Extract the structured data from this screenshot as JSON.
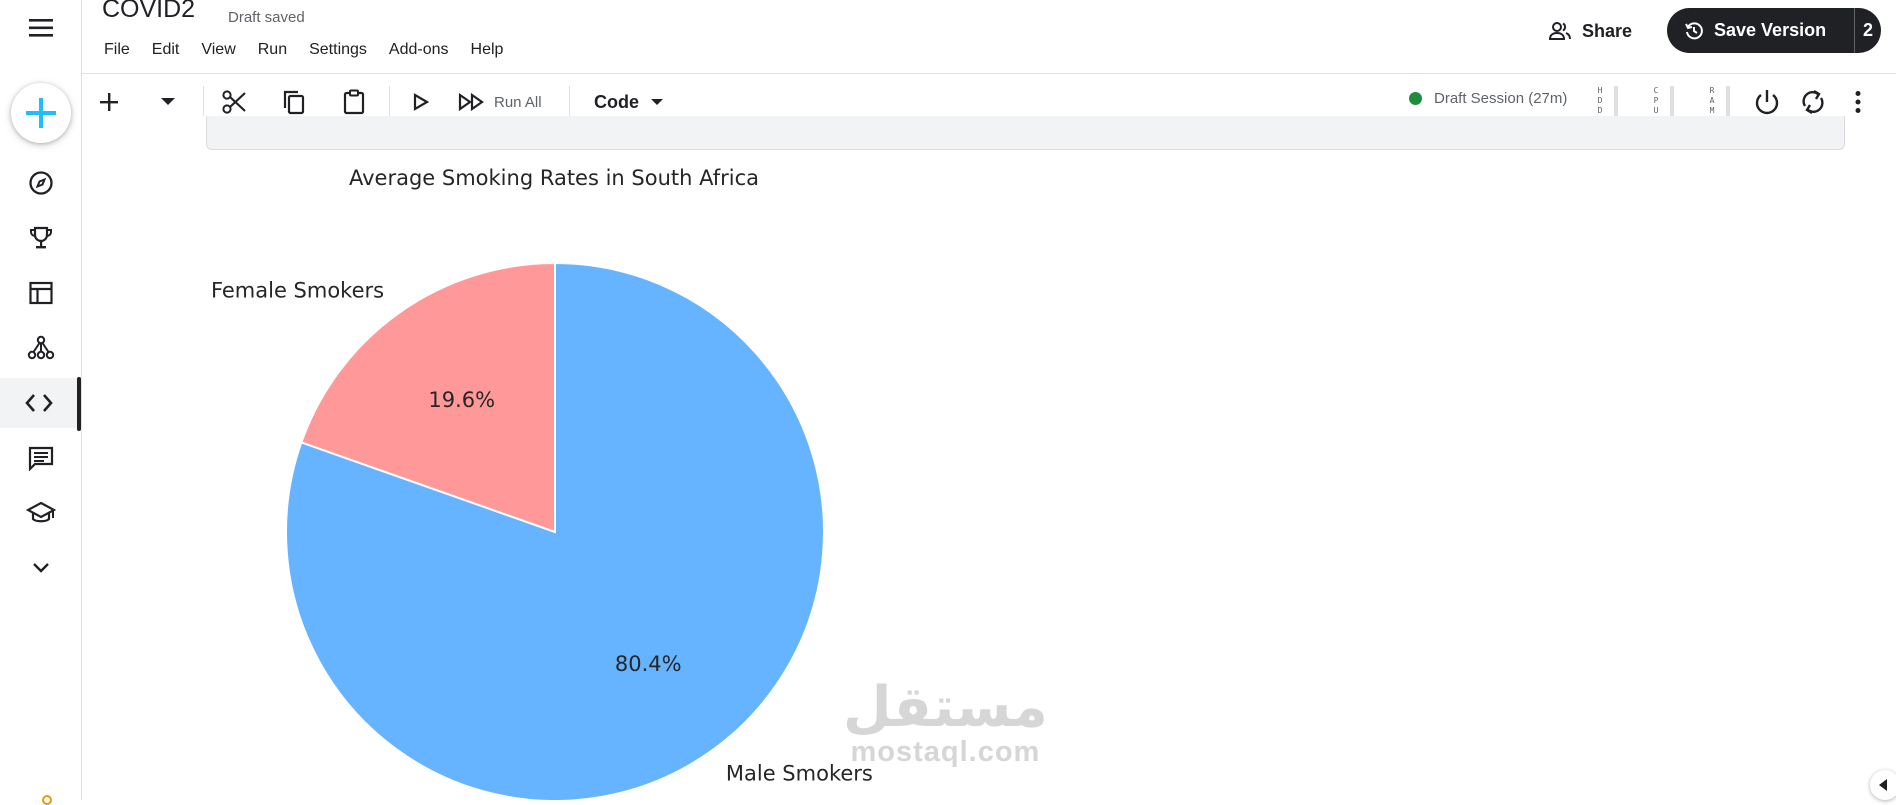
{
  "app": {
    "title": "COVID2",
    "save_status": "Draft saved"
  },
  "menu": [
    "File",
    "Edit",
    "View",
    "Run",
    "Settings",
    "Add-ons",
    "Help"
  ],
  "header": {
    "share_label": "Share",
    "save_version_label": "Save Version",
    "save_version_count": "2"
  },
  "toolbar": {
    "run_all_label": "Run All",
    "cell_type": "Code",
    "session_label": "Draft Session (27m)",
    "session_status_color": "#1e8e3e",
    "meters": [
      {
        "label": "HDD",
        "letters": [
          "H",
          "D",
          "D"
        ],
        "usage": 0.0
      },
      {
        "label": "CPU",
        "letters": [
          "C",
          "P",
          "U"
        ],
        "usage": 0.0
      },
      {
        "label": "RAM",
        "letters": [
          "R",
          "A",
          "M"
        ],
        "usage": 0.05
      }
    ]
  },
  "sidebar": {
    "items": [
      {
        "name": "create",
        "icon": "plus-icon"
      },
      {
        "name": "explore",
        "icon": "compass-icon"
      },
      {
        "name": "competitions",
        "icon": "trophy-icon"
      },
      {
        "name": "datasets",
        "icon": "table-icon"
      },
      {
        "name": "models",
        "icon": "models-icon"
      },
      {
        "name": "code",
        "icon": "code-icon",
        "active": true
      },
      {
        "name": "discussions",
        "icon": "comments-icon"
      },
      {
        "name": "learn",
        "icon": "school-icon"
      },
      {
        "name": "more",
        "icon": "chevron-down-icon"
      }
    ]
  },
  "chart_data": {
    "type": "pie",
    "title": "Average Smoking Rates in South Africa",
    "slices": [
      {
        "label": "Female Smokers",
        "value": 19.6,
        "display": "19.6%",
        "color": "#ff9999"
      },
      {
        "label": "Male Smokers",
        "value": 80.4,
        "display": "80.4%",
        "color": "#66b3ff"
      }
    ],
    "start_angle_deg": 90,
    "direction": "counterclockwise"
  },
  "watermark": {
    "arabic": "مستقل",
    "latin": "mostaql.com"
  }
}
